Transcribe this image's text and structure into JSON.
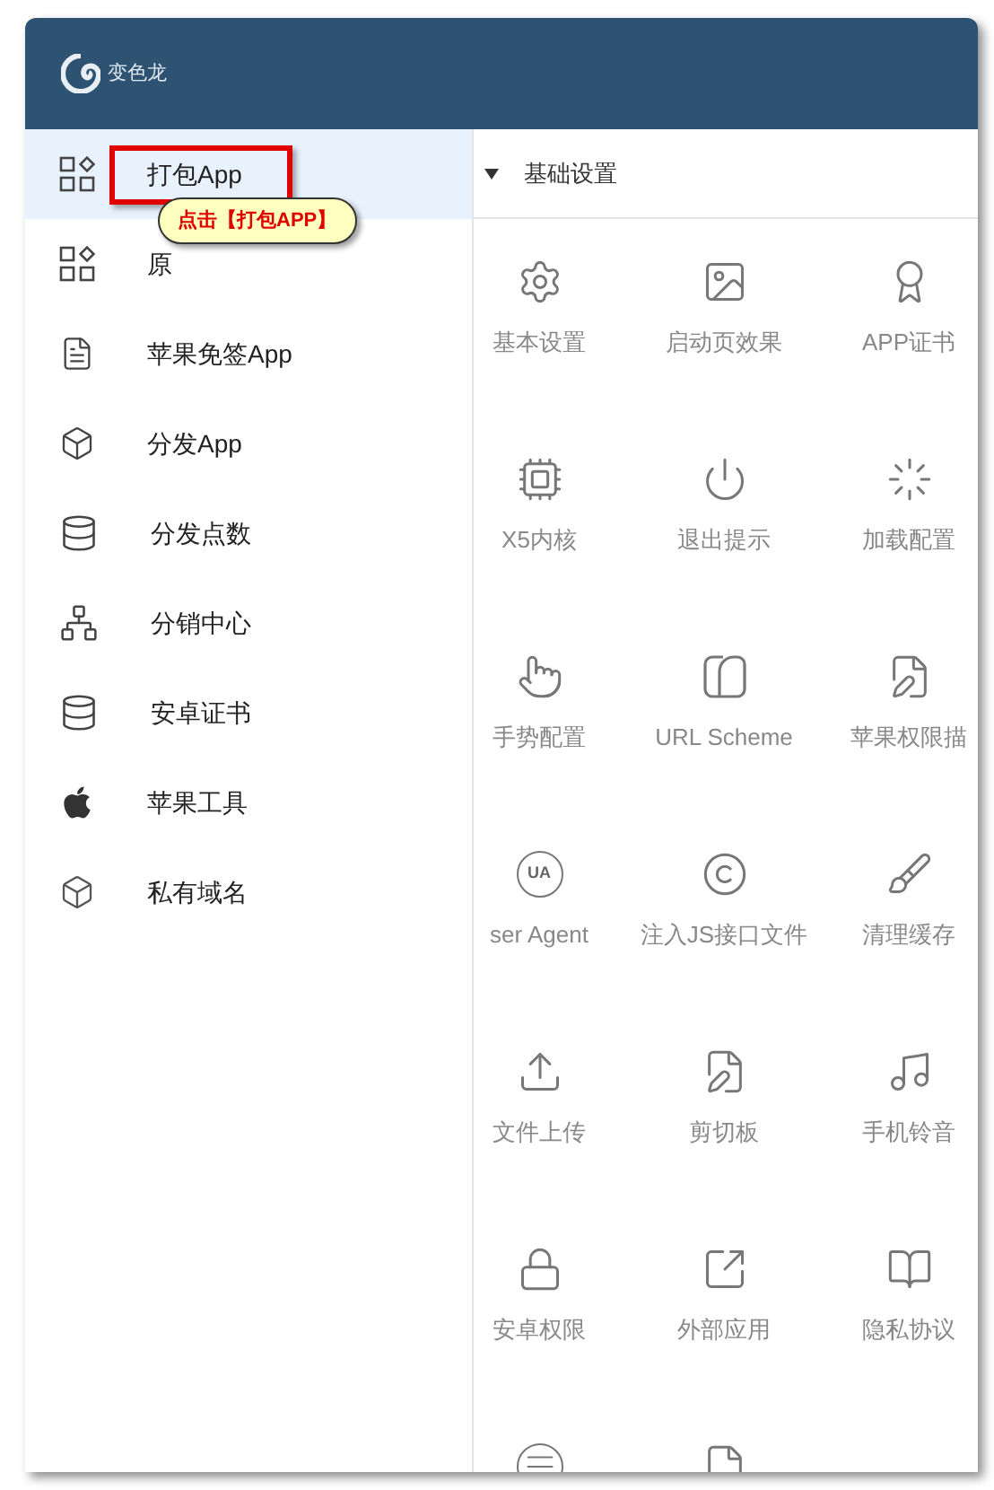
{
  "header": {
    "brand": "变色龙"
  },
  "sidebar": {
    "items": [
      {
        "label": "打包App",
        "selected": true,
        "highlighted": true
      },
      {
        "label": "原",
        "selected": false,
        "highlighted": false
      },
      {
        "label": "苹果免签App",
        "selected": false,
        "highlighted": false
      },
      {
        "label": "分发App",
        "selected": false,
        "highlighted": false
      },
      {
        "label": "分发点数",
        "selected": false,
        "highlighted": false
      },
      {
        "label": "分销中心",
        "selected": false,
        "highlighted": false
      },
      {
        "label": "安卓证书",
        "selected": false,
        "highlighted": false
      },
      {
        "label": "苹果工具",
        "selected": false,
        "highlighted": false
      },
      {
        "label": "私有域名",
        "selected": false,
        "highlighted": false
      }
    ]
  },
  "tooltip": {
    "text": "点击【打包APP】"
  },
  "section": {
    "title": "基础设置",
    "expanded": true,
    "items": [
      {
        "label": "基本设置"
      },
      {
        "label": "启动页效果"
      },
      {
        "label": "APP证书"
      },
      {
        "label": "X5内核"
      },
      {
        "label": "退出提示"
      },
      {
        "label": "加载配置"
      },
      {
        "label": "手势配置"
      },
      {
        "label": "URL Scheme"
      },
      {
        "label": "苹果权限描"
      },
      {
        "label": "ser Agent",
        "icon_text": "UA"
      },
      {
        "label": "注入JS接口文件"
      },
      {
        "label": "清理缓存"
      },
      {
        "label": "文件上传"
      },
      {
        "label": "剪切板"
      },
      {
        "label": "手机铃音"
      },
      {
        "label": "安卓权限"
      },
      {
        "label": "外部应用"
      },
      {
        "label": "隐私协议"
      }
    ]
  }
}
